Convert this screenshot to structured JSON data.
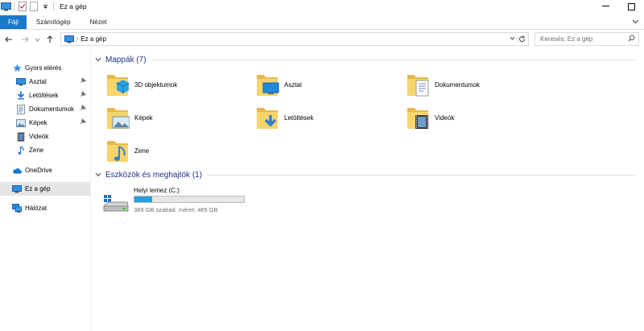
{
  "window": {
    "title": "Ez a gép",
    "accent_color": "#1979ca"
  },
  "ribbon": {
    "tabs": [
      "Fájl",
      "Számítógép",
      "Nézet"
    ]
  },
  "address": {
    "path": "Ez a gép",
    "search_placeholder": "Keresés: Ez a gép"
  },
  "sidebar": {
    "items": [
      {
        "label": "Gyors elérés",
        "icon": "star-icon"
      },
      {
        "label": "Asztal",
        "icon": "desktop-icon",
        "pinned": true
      },
      {
        "label": "Letöltések",
        "icon": "download-icon",
        "pinned": true
      },
      {
        "label": "Dokumentumok",
        "icon": "documents-icon",
        "pinned": true
      },
      {
        "label": "Képek",
        "icon": "pictures-icon",
        "pinned": true
      },
      {
        "label": "Videók",
        "icon": "videos-icon"
      },
      {
        "label": "Zene",
        "icon": "music-icon"
      },
      {
        "label": "OneDrive",
        "icon": "cloud-icon"
      },
      {
        "label": "Ez a gép",
        "icon": "computer-icon",
        "selected": true
      },
      {
        "label": "Hálózat",
        "icon": "network-icon"
      }
    ]
  },
  "content": {
    "folders_header": "Mappák (7)",
    "folders": [
      {
        "label": "3D objektumok",
        "icon": "3d-objects-folder-icon"
      },
      {
        "label": "Asztal",
        "icon": "desktop-folder-icon"
      },
      {
        "label": "Dokumentumok",
        "icon": "documents-folder-icon"
      },
      {
        "label": "Képek",
        "icon": "pictures-folder-icon"
      },
      {
        "label": "Letöltések",
        "icon": "downloads-folder-icon"
      },
      {
        "label": "Videók",
        "icon": "videos-folder-icon"
      },
      {
        "label": "Zene",
        "icon": "music-folder-icon"
      }
    ],
    "devices_header": "Eszközök és meghajtók (1)",
    "drive": {
      "name": "Helyi lemez (C:)",
      "info": "389 GB szabad, méret: 465 GB",
      "used_fraction": 0.163,
      "bar_color": "#26a0da"
    }
  }
}
